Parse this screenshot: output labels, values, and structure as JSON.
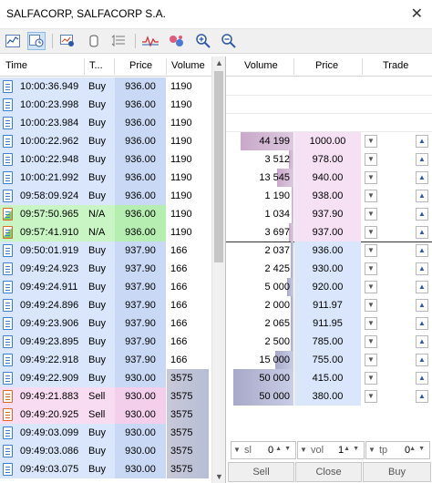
{
  "window": {
    "title": "SALFACORP, SALFACORP S.A."
  },
  "toolbar": {
    "icons": [
      "chart-icon",
      "time-sales-icon",
      "history-icon",
      "cylinder-icon",
      "list-settings-icon",
      "signal-icon",
      "bubbles-icon",
      "zoom-in-icon",
      "zoom-out-icon"
    ],
    "active": "time-sales-icon"
  },
  "ticks": {
    "headers": {
      "time": "Time",
      "type": "T...",
      "price": "Price",
      "volume": "Volume"
    },
    "rows": [
      {
        "time": "10:00:36.949",
        "type": "Buy",
        "price": "936.00",
        "volume": "1190",
        "kind": "buy"
      },
      {
        "time": "10:00:23.998",
        "type": "Buy",
        "price": "936.00",
        "volume": "1190",
        "kind": "buy"
      },
      {
        "time": "10:00:23.984",
        "type": "Buy",
        "price": "936.00",
        "volume": "1190",
        "kind": "buy"
      },
      {
        "time": "10:00:22.962",
        "type": "Buy",
        "price": "936.00",
        "volume": "1190",
        "kind": "buy"
      },
      {
        "time": "10:00:22.948",
        "type": "Buy",
        "price": "936.00",
        "volume": "1190",
        "kind": "buy"
      },
      {
        "time": "10:00:21.992",
        "type": "Buy",
        "price": "936.00",
        "volume": "1190",
        "kind": "buy"
      },
      {
        "time": "09:58:09.924",
        "type": "Buy",
        "price": "936.00",
        "volume": "1190",
        "kind": "buy"
      },
      {
        "time": "09:57:50.965",
        "type": "N/A",
        "price": "936.00",
        "volume": "1190",
        "kind": "na"
      },
      {
        "time": "09:57:41.910",
        "type": "N/A",
        "price": "936.00",
        "volume": "1190",
        "kind": "na"
      },
      {
        "time": "09:50:01.919",
        "type": "Buy",
        "price": "937.90",
        "volume": "166",
        "kind": "buy"
      },
      {
        "time": "09:49:24.923",
        "type": "Buy",
        "price": "937.90",
        "volume": "166",
        "kind": "buy"
      },
      {
        "time": "09:49:24.911",
        "type": "Buy",
        "price": "937.90",
        "volume": "166",
        "kind": "buy"
      },
      {
        "time": "09:49:24.896",
        "type": "Buy",
        "price": "937.90",
        "volume": "166",
        "kind": "buy"
      },
      {
        "time": "09:49:23.906",
        "type": "Buy",
        "price": "937.90",
        "volume": "166",
        "kind": "buy"
      },
      {
        "time": "09:49:23.895",
        "type": "Buy",
        "price": "937.90",
        "volume": "166",
        "kind": "buy"
      },
      {
        "time": "09:49:22.918",
        "type": "Buy",
        "price": "937.90",
        "volume": "166",
        "kind": "buy"
      },
      {
        "time": "09:49:22.909",
        "type": "Buy",
        "price": "930.00",
        "volume": "3575",
        "kind": "buy"
      },
      {
        "time": "09:49:21.883",
        "type": "Sell",
        "price": "930.00",
        "volume": "3575",
        "kind": "sell"
      },
      {
        "time": "09:49:20.925",
        "type": "Sell",
        "price": "930.00",
        "volume": "3575",
        "kind": "sell"
      },
      {
        "time": "09:49:03.099",
        "type": "Buy",
        "price": "930.00",
        "volume": "3575",
        "kind": "buy"
      },
      {
        "time": "09:49:03.086",
        "type": "Buy",
        "price": "930.00",
        "volume": "3575",
        "kind": "buy"
      },
      {
        "time": "09:49:03.075",
        "type": "Buy",
        "price": "930.00",
        "volume": "3575",
        "kind": "buy"
      }
    ]
  },
  "depth": {
    "headers": {
      "volume": "Volume",
      "price": "Price",
      "trade": "Trade"
    },
    "asks": [
      {
        "volume": "44 199",
        "price": "1000.00",
        "level": 0.88
      },
      {
        "volume": "3 512",
        "price": "978.00",
        "level": 0.08
      },
      {
        "volume": "13 545",
        "price": "940.00",
        "level": 0.27
      },
      {
        "volume": "1 190",
        "price": "938.00",
        "level": 0.03
      },
      {
        "volume": "1 034",
        "price": "937.90",
        "level": 0.03
      },
      {
        "volume": "3 697",
        "price": "937.00",
        "level": 0.08
      }
    ],
    "bids": [
      {
        "volume": "2 037",
        "price": "936.00",
        "level": 0.04
      },
      {
        "volume": "2 425",
        "price": "930.00",
        "level": 0.05
      },
      {
        "volume": "5 000",
        "price": "920.00",
        "level": 0.1
      },
      {
        "volume": "2 000",
        "price": "911.97",
        "level": 0.04
      },
      {
        "volume": "2 065",
        "price": "911.95",
        "level": 0.04
      },
      {
        "volume": "2 500",
        "price": "785.00",
        "level": 0.05
      },
      {
        "volume": "15 000",
        "price": "755.00",
        "level": 0.3
      },
      {
        "volume": "50 000",
        "price": "415.00",
        "level": 1.0
      },
      {
        "volume": "50 000",
        "price": "380.00",
        "level": 1.0
      }
    ]
  },
  "controls": {
    "sl": {
      "label": "sl",
      "value": "0"
    },
    "vol": {
      "label": "vol",
      "value": "1"
    },
    "tp": {
      "label": "tp",
      "value": "0"
    },
    "sell_label": "Sell",
    "close_label": "Close",
    "buy_label": "Buy"
  }
}
